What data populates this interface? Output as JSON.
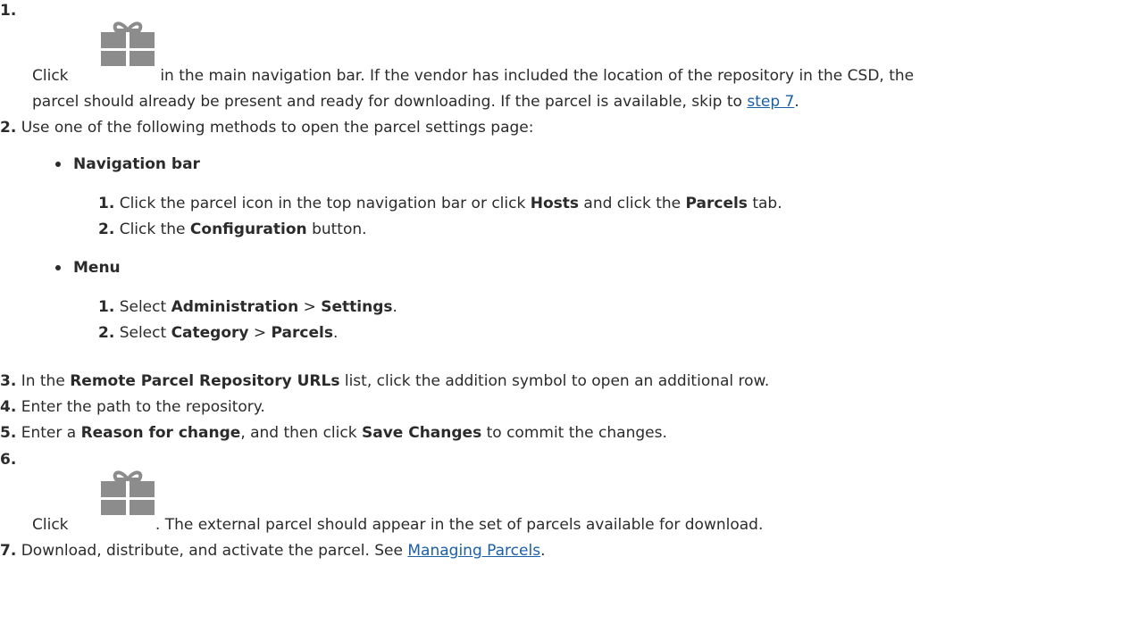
{
  "steps": {
    "s1": {
      "num": "1.",
      "click": "Click",
      "text_a": "in the main navigation bar. If the vendor has included the location of the repository in the CSD, the",
      "text_b": "parcel should already be present and ready for downloading. If the parcel is available, skip to",
      "link": "step 7",
      "end": "."
    },
    "s2": {
      "num": "2.",
      "text": "Use one of the following methods to open the parcel settings page:",
      "nav": {
        "title": "Navigation bar",
        "sub1": {
          "num": "1.",
          "a": "Click the parcel icon in the top navigation bar or click",
          "b1": "Hosts",
          "c": "and click the",
          "b2": "Parcels",
          "d": "tab."
        },
        "sub2": {
          "num": "2.",
          "a": "Click the",
          "b": "Configuration",
          "c": "button."
        }
      },
      "menu": {
        "title": "Menu",
        "sub1": {
          "num": "1.",
          "a": "Select",
          "b1": "Administration",
          "sep": ">",
          "b2": "Settings",
          "end": "."
        },
        "sub2": {
          "num": "2.",
          "a": "Select",
          "b1": "Category",
          "sep": ">",
          "b2": "Parcels",
          "end": "."
        }
      }
    },
    "s3": {
      "num": "3.",
      "a": "In the",
      "b": "Remote Parcel Repository URLs",
      "c": "list, click the addition symbol to open an additional row."
    },
    "s4": {
      "num": "4.",
      "text": "Enter the path to the repository."
    },
    "s5": {
      "num": "5.",
      "a": "Enter a",
      "b1": "Reason for change",
      "c": ", and then click",
      "b2": "Save Changes",
      "d": "to commit the changes."
    },
    "s6": {
      "num": "6.",
      "click": "Click",
      "text": ". The external parcel should appear in the set of parcels available for download."
    },
    "s7": {
      "num": "7.",
      "text": "Download, distribute, and activate the parcel. See",
      "link": "Managing Parcels",
      "end": "."
    }
  },
  "icons": {
    "gift": "parcel-gift-icon",
    "color": "#8c8c8c"
  }
}
